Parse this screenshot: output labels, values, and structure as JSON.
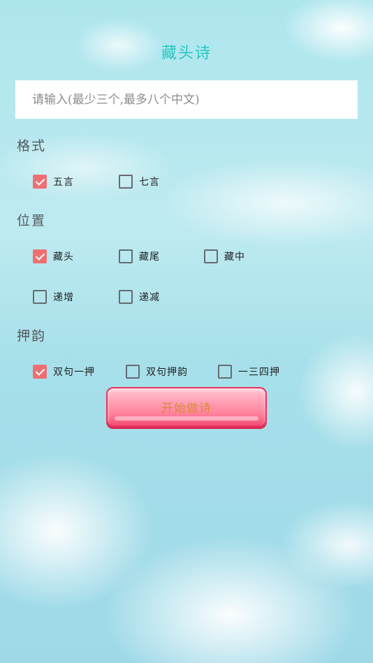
{
  "app": {
    "title": "藏头诗"
  },
  "input": {
    "placeholder": "请输入(最少三个,最多八个中文)",
    "value": ""
  },
  "format": {
    "label": "格式",
    "options": [
      {
        "label": "五言",
        "checked": true
      },
      {
        "label": "七言",
        "checked": false
      }
    ]
  },
  "position": {
    "label": "位置",
    "options": [
      {
        "label": "藏头",
        "checked": true
      },
      {
        "label": "藏尾",
        "checked": false
      },
      {
        "label": "藏中",
        "checked": false
      },
      {
        "label": "递增",
        "checked": false
      },
      {
        "label": "递减",
        "checked": false
      }
    ]
  },
  "rhyme": {
    "label": "押韵",
    "options": [
      {
        "label": "双句一押",
        "checked": true
      },
      {
        "label": "双句押韵",
        "checked": false
      },
      {
        "label": "一三四押",
        "checked": false
      }
    ]
  },
  "start_button": {
    "label": "开始做诗"
  },
  "colors": {
    "title": "#27c7c3",
    "checked": "#ee6f72",
    "button": "#ff8fa8",
    "button_text": "#d98a3a"
  }
}
